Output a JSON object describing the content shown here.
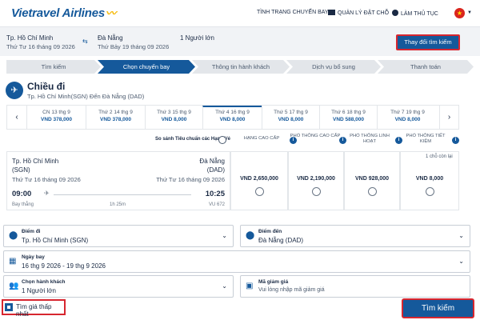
{
  "header": {
    "logo_text": "Vietravel Airlines",
    "nav": [
      {
        "label": "TÌNH TRẠNG CHUYẾN BAY"
      },
      {
        "label": "QUẢN LÝ ĐẶT CHỖ"
      },
      {
        "label": "LÀM THỦ TỤC"
      }
    ],
    "flag_symbol": "★"
  },
  "summary": {
    "from_city": "Tp. Hồ Chí Minh",
    "from_date": "Thứ Tư 16 tháng 09 2026",
    "to_city": "Đà Nẵng",
    "to_date": "Thứ Bảy 19 tháng 09 2026",
    "passengers": "1 Người lớn",
    "change_button": "Thay đổi tìm kiếm"
  },
  "steps": [
    {
      "label": "Tìm kiếm",
      "active": false
    },
    {
      "label": "Chọn chuyến bay",
      "active": true
    },
    {
      "label": "Thông tin hành khách",
      "active": false
    },
    {
      "label": "Dịch vụ bổ sung",
      "active": false
    },
    {
      "label": "Thanh toán",
      "active": false
    }
  ],
  "direction": {
    "title": "Chiều đi",
    "subtitle": "Tp. Hồ Chí Minh(SGN) Đến Đà Nẵng (DAD)"
  },
  "dates": [
    {
      "day": "CN 13 thg 9",
      "price": "VND 378,000"
    },
    {
      "day": "Thứ 2 14 thg 9",
      "price": "VND 378,000"
    },
    {
      "day": "Thứ 3 15 thg 9",
      "price": "VND 8,000"
    },
    {
      "day": "Thứ 4 16 thg 9",
      "price": "VND 8,000"
    },
    {
      "day": "Thứ 5 17 thg 9",
      "price": "VND 8,000"
    },
    {
      "day": "Thứ 6 18 thg 9",
      "price": "VND 588,000"
    },
    {
      "day": "Thứ 7 19 thg 9",
      "price": "VND 8,000"
    }
  ],
  "fare_compare": {
    "label": "So sánh Tiêu chuẩn các Hạng Vé",
    "classes": [
      {
        "name": "HẠNG CAO CẤP"
      },
      {
        "name": "PHỔ THÔNG CAO CẤP"
      },
      {
        "name": "PHỔ THÔNG LINH HOẠT"
      },
      {
        "name": "PHỔ THÔNG TIẾT KIỆM"
      }
    ]
  },
  "flight": {
    "from_city": "Tp. Hồ Chí Minh",
    "from_code": "(SGN)",
    "to_city": "Đà Nẵng",
    "to_code": "(DAD)",
    "date_from": "Thứ Tư 16 tháng 09 2026",
    "date_to": "Thứ Tư 16 tháng 09 2026",
    "depart_time": "09:00",
    "arrive_time": "10:25",
    "type": "Bay thẳng",
    "duration": "1h 25m",
    "flight_no": "VU 672",
    "prices": [
      "VND 2,650,000",
      "VND 2,190,000",
      "VND 928,000",
      "VND 8,000"
    ],
    "seat_note": "1 chỗ còn lại"
  },
  "form": {
    "origin_label": "Điểm đi",
    "origin_value": "Tp. Hồ Chí Minh (SGN)",
    "dest_label": "Điểm đến",
    "dest_value": "Đà Nẵng (DAD)",
    "date_label": "Ngày bay",
    "date_value": "16 thg 9 2026 - 19 thg 9 2026",
    "pax_label": "Chọn hành khách",
    "pax_value": "1 Người lớn",
    "promo_label": "Mã giảm giá",
    "promo_placeholder": "Vui lòng nhập mã giảm giá"
  },
  "cheapest_label": "Tìm giá thấp nhất",
  "search_button": "Tìm kiếm",
  "colors": {
    "brand": "#15599b",
    "highlight": "#d7262f",
    "logo_accent": "#f5b700"
  }
}
